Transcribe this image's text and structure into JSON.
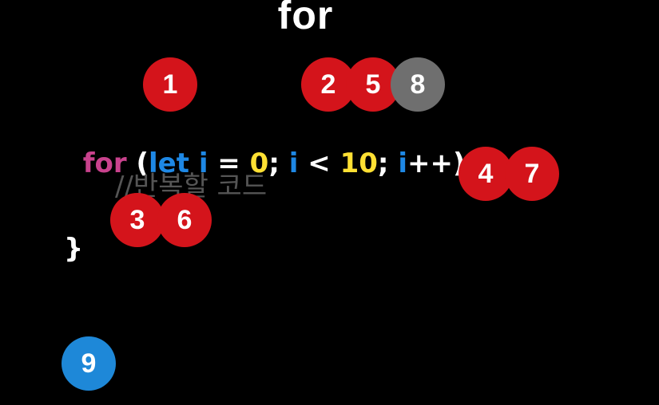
{
  "title": "for",
  "code": {
    "line1": [
      {
        "text": "for",
        "role": "keyword"
      },
      {
        "text": " (",
        "role": "punct"
      },
      {
        "text": "let",
        "role": "keyword2"
      },
      {
        "text": " ",
        "role": "punct"
      },
      {
        "text": "i",
        "role": "variable"
      },
      {
        "text": " = ",
        "role": "punct"
      },
      {
        "text": "0",
        "role": "number"
      },
      {
        "text": "; ",
        "role": "punct"
      },
      {
        "text": "i",
        "role": "variable"
      },
      {
        "text": " < ",
        "role": "punct"
      },
      {
        "text": "10",
        "role": "number"
      },
      {
        "text": "; ",
        "role": "punct"
      },
      {
        "text": "i",
        "role": "variable"
      },
      {
        "text": "++) {",
        "role": "punct"
      }
    ],
    "line2": "//반복할 코드",
    "line3": "}"
  },
  "badges": [
    {
      "label": "1",
      "color": "#d4141b"
    },
    {
      "label": "2",
      "color": "#d4141b"
    },
    {
      "label": "5",
      "color": "#d4141b"
    },
    {
      "label": "8",
      "color": "#6f6f6f"
    },
    {
      "label": "4",
      "color": "#d4141b"
    },
    {
      "label": "7",
      "color": "#d4141b"
    },
    {
      "label": "3",
      "color": "#d4141b"
    },
    {
      "label": "6",
      "color": "#d4141b"
    },
    {
      "label": "9",
      "color": "#1e88d8"
    }
  ],
  "colors": {
    "background": "#000000",
    "keyword_for": "#c9428d",
    "keyword_let": "#1e88e5",
    "variable": "#1e88e5",
    "number": "#ffe033",
    "punctuation": "#ffffff",
    "comment": "#555555"
  }
}
